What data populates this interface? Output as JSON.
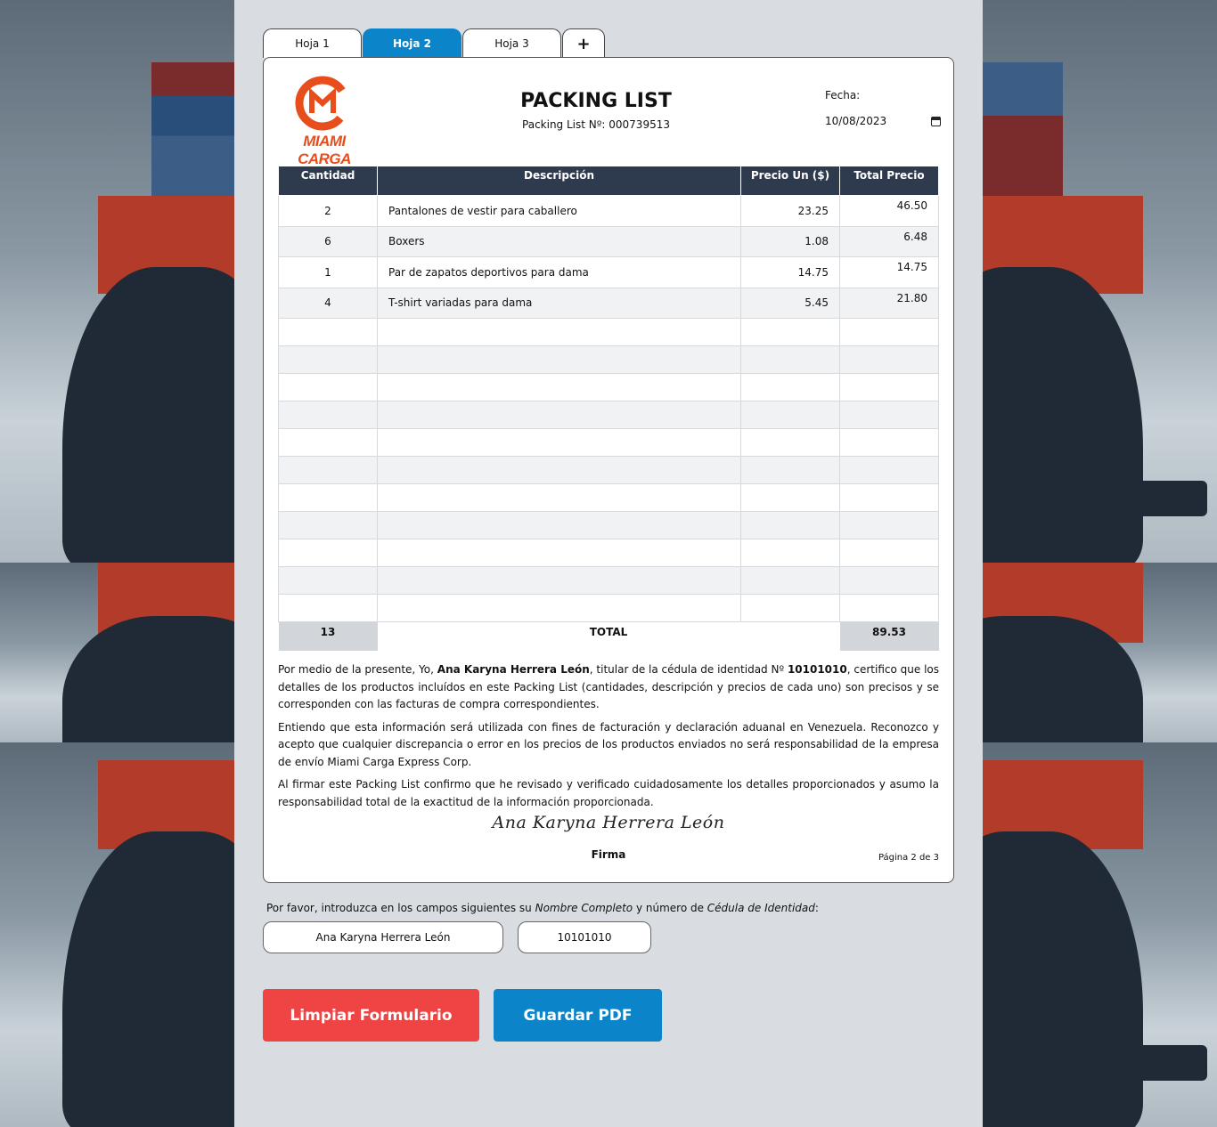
{
  "tabs": [
    {
      "label": "Hoja 1"
    },
    {
      "label": "Hoja 2"
    },
    {
      "label": "Hoja 3"
    },
    {
      "label": "+"
    }
  ],
  "sheet": {
    "logo_text": "MIAMI CARGA",
    "title": "PACKING LIST",
    "packing_no": "Packing List Nº: 000739513",
    "fecha_label": "Fecha:",
    "fecha_value": "10/08/2023",
    "table": {
      "headers": [
        "Cantidad",
        "Descripción",
        "Precio Un ($)",
        "Total Precio"
      ],
      "rows": [
        {
          "qty": "2",
          "desc": "Pantalones de vestir para caballero",
          "price": "23.25",
          "total": "46.50"
        },
        {
          "qty": "6",
          "desc": "Boxers",
          "price": "1.08",
          "total": "6.48"
        },
        {
          "qty": "1",
          "desc": "Par de zapatos deportivos para dama",
          "price": "14.75",
          "total": "14.75"
        },
        {
          "qty": "4",
          "desc": "T-shirt variadas para dama",
          "price": "5.45",
          "total": "21.80"
        }
      ],
      "total_qty": "13",
      "total_label": "TOTAL",
      "total_amount": "89.53"
    },
    "legal": {
      "p1_a": "Por medio de la presente, Yo, ",
      "p1_name": "Ana Karyna Herrera León",
      "p1_b": ", titular de la cédula de identidad Nº ",
      "p1_id": "10101010",
      "p1_c": ", certifico que los detalles de los productos incluídos en este Packing List (cantidades, descripción y precios de cada uno) son precisos y se corresponden con las facturas de compra correspondientes.",
      "p2": "Entiendo que esta información será utilizada con fines de facturación y declaración aduanal en Venezuela. Reconozco y acepto que cualquier discrepancia o error en los precios de los productos enviados no será responsabilidad de la empresa de envío Miami Carga Express Corp.",
      "p3": "Al firmar este Packing List confirmo que he revisado y verificado cuidadosamente los detalles proporcionados y asumo la responsabilidad total de la exactitud de la información proporcionada."
    },
    "signature": "Ana Karyna Herrera León",
    "firma_label": "Firma",
    "page_label": "Página 2 de 3"
  },
  "form": {
    "instructions_a": "Por favor, introduzca en los campos siguientes su ",
    "instructions_b": "Nombre Completo",
    "instructions_c": " y número de ",
    "instructions_d": "Cédula de Identidad",
    "instructions_e": ":",
    "name_value": "Ana Karyna Herrera León",
    "id_value": "10101010",
    "clear_label": "Limpiar Formulario",
    "save_label": "Guardar PDF"
  },
  "colors": {
    "accent": "#0b84c9",
    "danger": "#ee4444",
    "table_header": "#2e3b4e",
    "logo": "#e84e1b"
  }
}
